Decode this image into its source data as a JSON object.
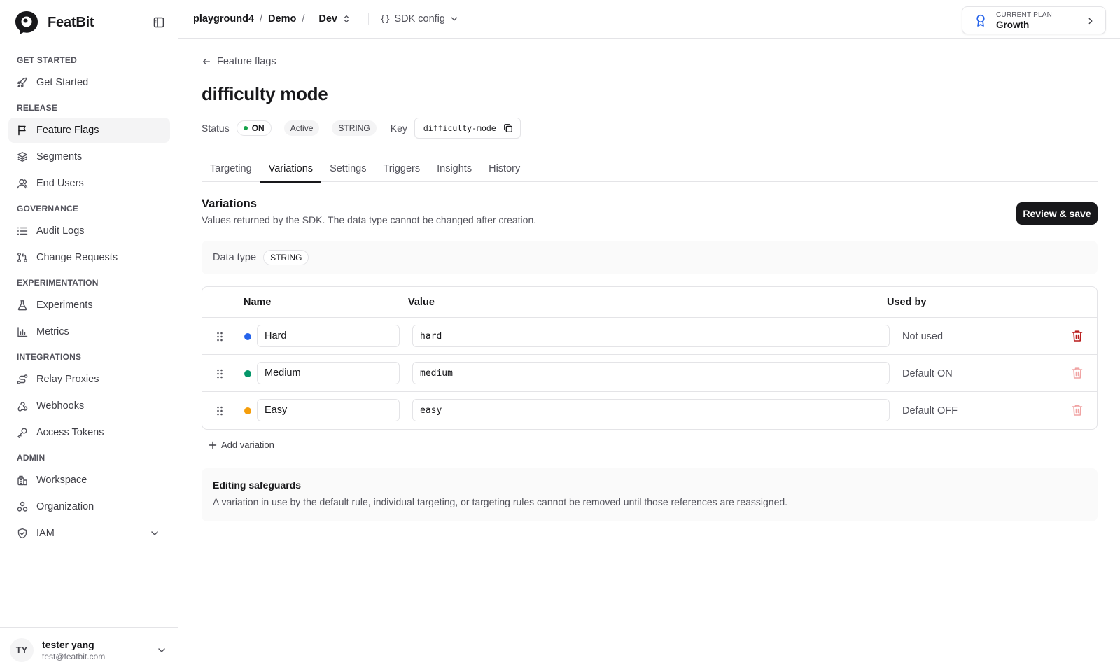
{
  "brand": {
    "name": "FeatBit"
  },
  "sidebar": {
    "sections": [
      {
        "title": "GET STARTED",
        "items": [
          {
            "label": "Get Started"
          }
        ]
      },
      {
        "title": "RELEASE",
        "items": [
          {
            "label": "Feature Flags"
          },
          {
            "label": "Segments"
          },
          {
            "label": "End Users"
          }
        ]
      },
      {
        "title": "GOVERNANCE",
        "items": [
          {
            "label": "Audit Logs"
          },
          {
            "label": "Change Requests"
          }
        ]
      },
      {
        "title": "EXPERIMENTATION",
        "items": [
          {
            "label": "Experiments"
          },
          {
            "label": "Metrics"
          }
        ]
      },
      {
        "title": "INTEGRATIONS",
        "items": [
          {
            "label": "Relay Proxies"
          },
          {
            "label": "Webhooks"
          },
          {
            "label": "Access Tokens"
          }
        ]
      },
      {
        "title": "ADMIN",
        "items": [
          {
            "label": "Workspace"
          },
          {
            "label": "Organization"
          },
          {
            "label": "IAM"
          }
        ]
      }
    ],
    "active_item": "Feature Flags"
  },
  "user": {
    "initials": "TY",
    "name": "tester yang",
    "email": "test@featbit.com"
  },
  "header": {
    "project": "playground4",
    "environment_group": "Demo",
    "environment": "Dev",
    "sdk_config": "SDK config",
    "plan_label": "CURRENT PLAN",
    "plan_value": "Growth"
  },
  "flag": {
    "back_label": "Feature flags",
    "title": "difficulty mode",
    "status_label": "Status",
    "status_value": "ON",
    "state": "Active",
    "type": "STRING",
    "key_label": "Key",
    "key_value": "difficulty-mode"
  },
  "tabs": [
    {
      "label": "Targeting"
    },
    {
      "label": "Variations"
    },
    {
      "label": "Settings"
    },
    {
      "label": "Triggers"
    },
    {
      "label": "Insights"
    },
    {
      "label": "History"
    }
  ],
  "active_tab": "Variations",
  "variations": {
    "title": "Variations",
    "description": "Values returned by the SDK. The data type cannot be changed after creation.",
    "save_label": "Review & save",
    "data_type_label": "Data type",
    "data_type_value": "STRING",
    "columns": {
      "name": "Name",
      "value": "Value",
      "used_by": "Used by"
    },
    "rows": [
      {
        "name": "Hard",
        "value": "hard",
        "used_by": "Not used",
        "color": "#2563eb",
        "deletable": true
      },
      {
        "name": "Medium",
        "value": "medium",
        "used_by": "Default ON",
        "color": "#059669",
        "deletable": false
      },
      {
        "name": "Easy",
        "value": "easy",
        "used_by": "Default OFF",
        "color": "#f59e0b",
        "deletable": false
      }
    ],
    "add_label": "Add variation"
  },
  "safeguards": {
    "title": "Editing safeguards",
    "text": "A variation in use by the default rule, individual targeting, or targeting rules cannot be removed until those references are reassigned."
  },
  "colors": {
    "accent": "#18181b",
    "danger": "#b91c1c",
    "danger_muted": "#f0a3a3",
    "on": "#16a34a"
  }
}
